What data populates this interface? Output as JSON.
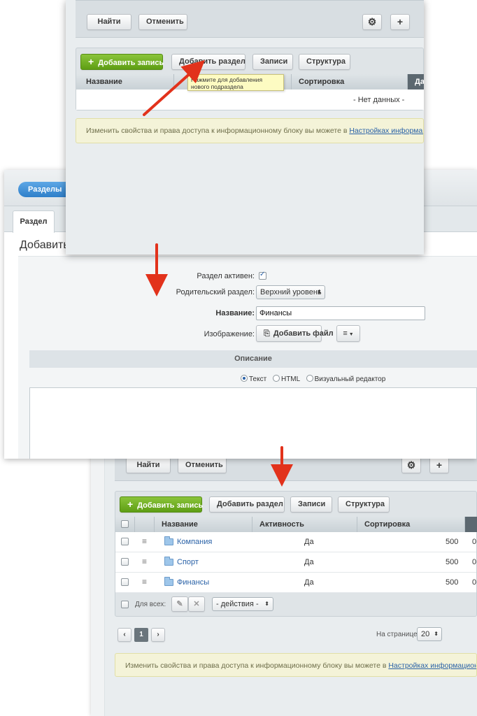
{
  "top_panel": {
    "filter_buttons": {
      "find": "Найти",
      "cancel": "Отменить"
    },
    "settings_icon": "gear-icon",
    "add_icon": "plus-icon",
    "toolbar": {
      "add_record": "Добавить запись",
      "add_section": "Добавить раздел",
      "records": "Записи",
      "structure": "Структура"
    },
    "columns": [
      "Название",
      "Сортировка",
      "Да"
    ],
    "tooltip": "Нажмите для добавления нового подраздела",
    "empty_text": "- Нет данных -",
    "notice_text": "Изменить свойства и права доступа к информационному блоку вы можете в",
    "notice_link": "Настройках информационного"
  },
  "middle_panel": {
    "breadcrumb": "Разделы",
    "tab": "Раздел",
    "title": "Добавить",
    "form": {
      "active_label": "Раздел активен:",
      "parent_label": "Родительский раздел:",
      "parent_value": "Верхний уровень",
      "name_label": "Название:",
      "name_value": "Финансы",
      "image_label": "Изображение:",
      "add_file": "Добавить файл"
    },
    "description_header": "Описание",
    "editor_modes": {
      "text": "Текст",
      "html": "HTML",
      "visual": "Визуальный редактор"
    }
  },
  "bottom_panel": {
    "filter_buttons": {
      "find": "Найти",
      "cancel": "Отменить"
    },
    "toolbar": {
      "add_record": "Добавить запись",
      "add_section": "Добавить раздел",
      "records": "Записи",
      "structure": "Структура"
    },
    "columns": {
      "name": "Название",
      "activity": "Активность",
      "sort": "Сортировка"
    },
    "rows": [
      {
        "name": "Компания",
        "active": "Да",
        "sort": "500",
        "extra": "0"
      },
      {
        "name": "Спорт",
        "active": "Да",
        "sort": "500",
        "extra": "0"
      },
      {
        "name": "Финансы",
        "active": "Да",
        "sort": "500",
        "extra": "0"
      }
    ],
    "for_all": "Для всех:",
    "actions": "- действия -",
    "pagination": {
      "current": "1",
      "per_page_label": "На странице:",
      "per_page_value": "20"
    },
    "notice_text": "Изменить свойства и права доступа к информационному блоку вы можете в",
    "notice_link": "Настройках информационного бло"
  },
  "colors": {
    "accent_green": "#6aab1f",
    "arrow_red": "#e2321b",
    "link": "#2a62a7"
  }
}
